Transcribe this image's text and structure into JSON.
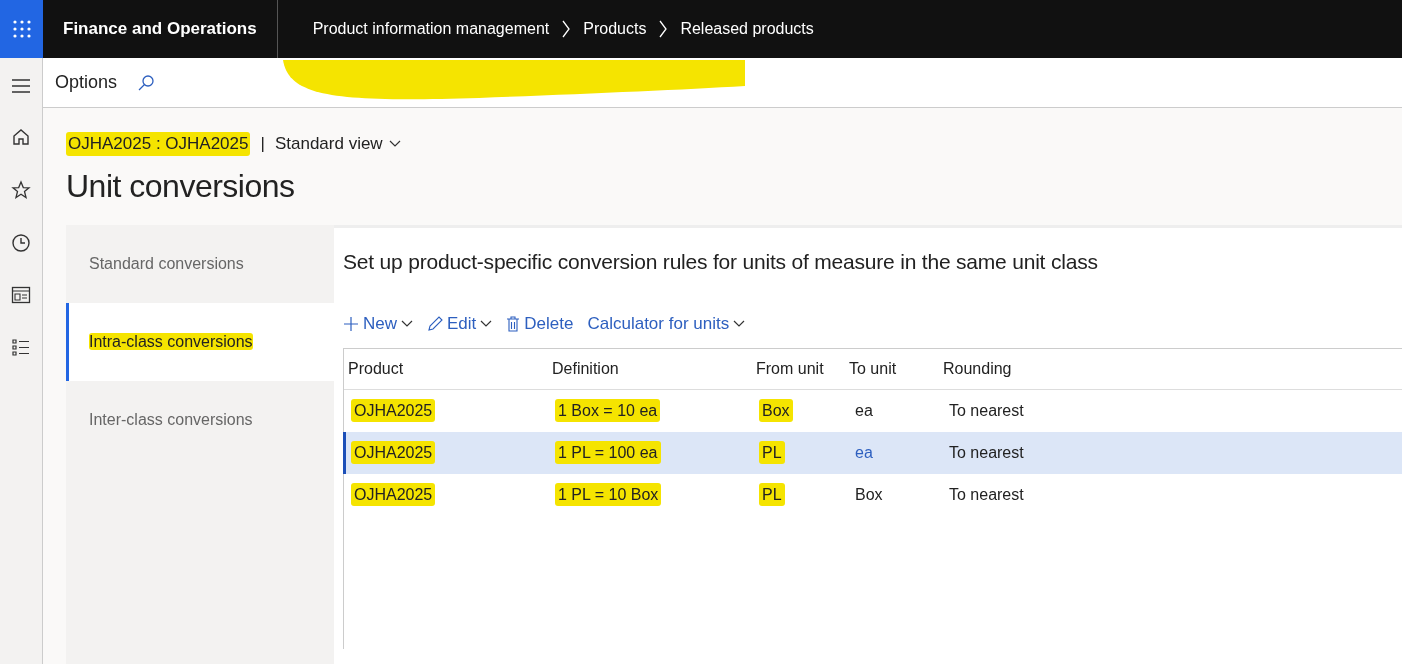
{
  "app_bar": {
    "app_name": "Finance and Operations",
    "breadcrumb": [
      "Product information management",
      "Products",
      "Released products"
    ],
    "breadcrumb_highlighted": true
  },
  "action_bar": {
    "options": "Options"
  },
  "record": {
    "title": "OJHA2025 : OJHA2025",
    "highlighted": true,
    "separator": "|",
    "view": "Standard view"
  },
  "page_title": "Unit conversions",
  "tabs": [
    {
      "label": "Standard conversions",
      "selected": false,
      "highlighted": false
    },
    {
      "label": "Intra-class conversions",
      "selected": true,
      "highlighted": true
    },
    {
      "label": "Inter-class conversions",
      "selected": false,
      "highlighted": false
    }
  ],
  "heading": "Set up product-specific conversion rules for units of measure in the same unit class",
  "toolbar": [
    {
      "label": "New",
      "kind": "new",
      "dropdown": true
    },
    {
      "label": "Edit",
      "kind": "edit",
      "dropdown": true
    },
    {
      "label": "Delete",
      "kind": "delete",
      "dropdown": false
    },
    {
      "label": "Calculator for units",
      "kind": "plain",
      "dropdown": true
    }
  ],
  "table": {
    "columns": [
      "Product",
      "Definition",
      "From unit",
      "To unit",
      "Rounding"
    ],
    "rows": [
      {
        "selected": false,
        "cells": [
          {
            "text": "OJHA2025",
            "highlighted": true
          },
          {
            "text": "1 Box = 10 ea",
            "highlighted": true
          },
          {
            "text": "Box",
            "highlighted": true
          },
          {
            "text": "ea",
            "highlighted": false
          },
          {
            "text": "To nearest",
            "highlighted": false
          }
        ]
      },
      {
        "selected": true,
        "cells": [
          {
            "text": "OJHA2025",
            "highlighted": true
          },
          {
            "text": "1 PL = 100 ea",
            "highlighted": true
          },
          {
            "text": "PL",
            "highlighted": true
          },
          {
            "text": "ea",
            "highlighted": false
          },
          {
            "text": "To nearest",
            "highlighted": false
          }
        ]
      },
      {
        "selected": false,
        "cells": [
          {
            "text": "OJHA2025",
            "highlighted": true
          },
          {
            "text": "1 PL = 10 Box",
            "highlighted": true
          },
          {
            "text": "PL",
            "highlighted": true
          },
          {
            "text": "Box",
            "highlighted": false
          },
          {
            "text": "To nearest",
            "highlighted": false
          }
        ]
      }
    ]
  }
}
